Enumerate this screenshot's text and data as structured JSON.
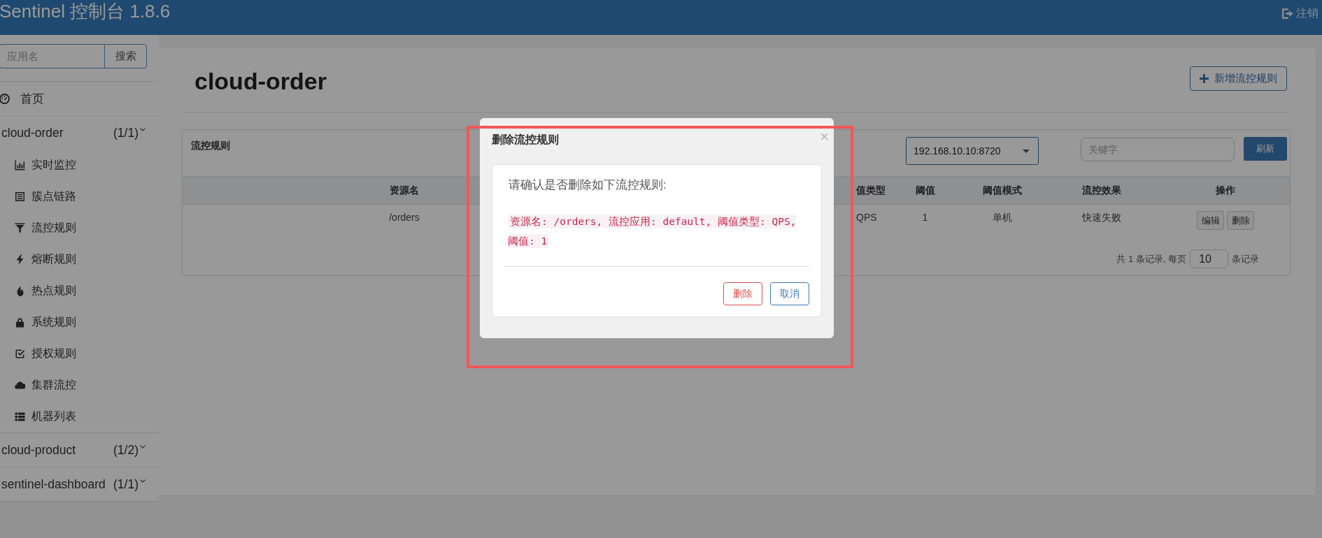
{
  "navbar": {
    "title": "Sentinel 控制台 1.8.6",
    "logout": "注销"
  },
  "sidebar": {
    "search": {
      "placeholder": "应用名",
      "button": "搜索"
    },
    "home": "首页",
    "apps": [
      {
        "name": "cloud-order",
        "count": "(1/1)",
        "items": [
          "实时监控",
          "簇点链路",
          "流控规则",
          "熔断规则",
          "热点规则",
          "系统规则",
          "授权规则",
          "集群流控",
          "机器列表"
        ]
      },
      {
        "name": "cloud-product",
        "count": "(1/2)"
      },
      {
        "name": "sentinel-dashboard",
        "count": "(1/1)"
      }
    ]
  },
  "page": {
    "title": "cloud-order",
    "add_button": "新增流控规则"
  },
  "rules_panel": {
    "title": "流控规则",
    "machine_select": {
      "value": "192.168.10.10:8720"
    },
    "keyword": {
      "placeholder": "关键字"
    },
    "refresh_button": "刷新",
    "columns": [
      "资源名",
      "值类型",
      "阈值",
      "阈值模式",
      "流控效果",
      "操作"
    ],
    "rows": [
      {
        "cells": [
          "/orders",
          "QPS",
          "1",
          "单机",
          "快速失败"
        ],
        "actions": [
          "编辑",
          "删除"
        ]
      }
    ],
    "pagination": {
      "summary": "共 1 条记录, 每页",
      "page_size": "10",
      "suffix": "条记录"
    }
  },
  "dialog": {
    "title": "删除流控规则",
    "close": "×",
    "message": "请确认是否删除如下流控规则:",
    "detail": "资源名: /orders, 流控应用: default, 阈值类型: QPS, 阈值: 1",
    "buttons": [
      {
        "label": "删除",
        "kind": "danger"
      },
      {
        "label": "取消",
        "kind": "default"
      }
    ]
  }
}
